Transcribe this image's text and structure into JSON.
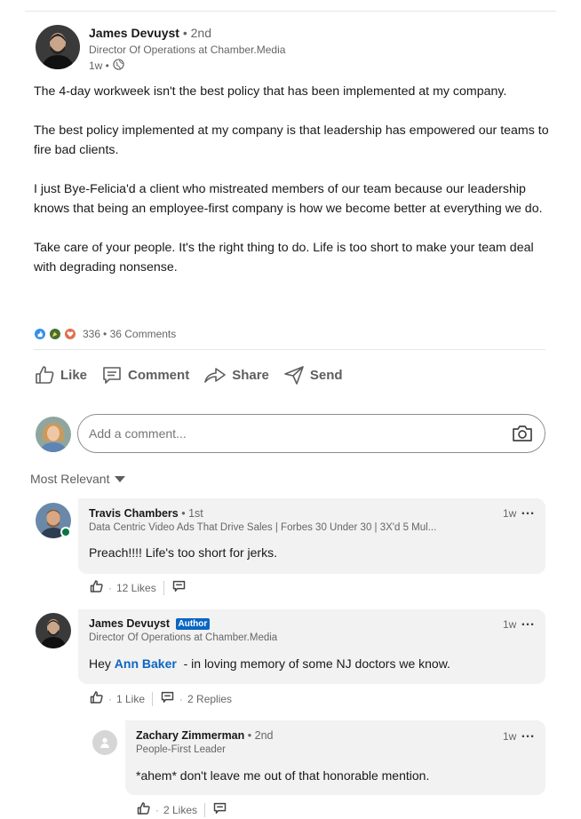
{
  "post": {
    "author_name": "James Devuyst",
    "author_degree": "• 2nd",
    "author_headline": "Director Of Operations at Chamber.Media",
    "time": "1w •",
    "paragraphs": [
      "The 4-day workweek isn't the best policy that has been implemented at my company.",
      "The best policy implemented at my company is that leadership has empowered our teams to fire bad clients.",
      "I just Bye-Felicia'd a client who mistreated members of our team because our leadership knows that being an employee-first company is how we become better at everything we do.",
      "Take care of your people. It's the right thing to do. Life is too short to make your team deal with degrading nonsense."
    ],
    "reaction_count": "336",
    "comment_count": "• 36 Comments",
    "reaction_icons": [
      "like-icon",
      "celebrate-icon",
      "love-icon"
    ],
    "reaction_colors": [
      "#378fe9",
      "#44712e",
      "#df704d"
    ]
  },
  "actions": {
    "like": "Like",
    "comment": "Comment",
    "share": "Share",
    "send": "Send"
  },
  "comment_input": {
    "placeholder": "Add a comment..."
  },
  "sort": {
    "label": "Most Relevant"
  },
  "comments": [
    {
      "name": "Travis Chambers",
      "degree": "• 1st",
      "headline": "Data Centric Video Ads That Drive Sales | Forbes 30 Under 30 | 3X'd 5 Mul...",
      "time": "1w",
      "text": "Preach!!!! Life's too short for jerks.",
      "likes": "12 Likes"
    },
    {
      "name": "James Devuyst",
      "badge": "Author",
      "headline": "Director Of Operations at Chamber.Media",
      "time": "1w",
      "text_prefix": "Hey ",
      "mention": "Ann Baker",
      "text_suffix": "  - in loving memory of some NJ doctors we know.",
      "likes": "1 Like",
      "replies": "2 Replies"
    },
    {
      "name": "Zachary Zimmerman",
      "degree": "• 2nd",
      "headline": "People-First Leader",
      "time": "1w",
      "text": "*ahem* don't leave me out of that honorable mention.",
      "likes": "2 Likes"
    }
  ],
  "colors": {
    "brand_blue": "#0a66c2",
    "bubble_bg": "#f2f2f2",
    "online_green": "#057642"
  }
}
